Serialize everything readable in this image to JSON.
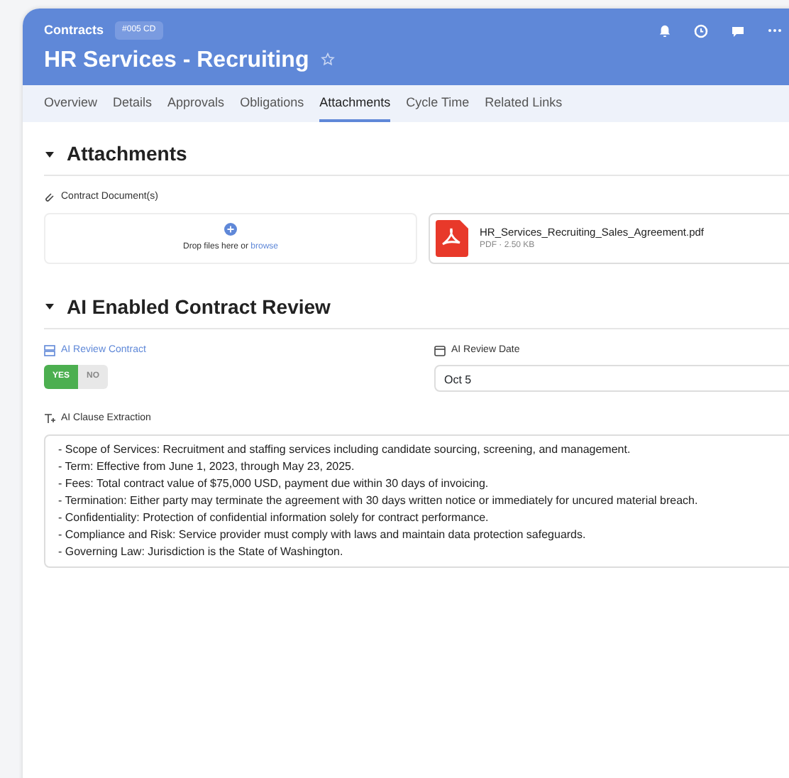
{
  "header": {
    "breadcrumb": "Contracts",
    "badge": "#005 CD",
    "title": "HR Services - Recruiting",
    "starred": false
  },
  "tabs": [
    {
      "label": "Overview",
      "selected": false
    },
    {
      "label": "Details",
      "selected": false
    },
    {
      "label": "Approvals",
      "selected": false
    },
    {
      "label": "Obligations",
      "selected": false
    },
    {
      "label": "Attachments",
      "selected": true
    },
    {
      "label": "Cycle Time",
      "selected": false
    },
    {
      "label": "Related Links",
      "selected": false
    }
  ],
  "attachments": {
    "heading": "Attachments",
    "expanded": true,
    "field_label": "Contract Document(s)",
    "drop_text": "Drop files here or",
    "browse_link": "browse",
    "files": [
      {
        "name": "HR_Services_Recruiting_Sales_Agreement.pdf",
        "meta": "PDF · 2.50 KB"
      }
    ]
  },
  "review": {
    "heading": "AI Enabled Contract Review",
    "expanded": true,
    "toggle_label": "AI Review Contract",
    "toggle_options": [
      {
        "label": "YES",
        "selected": true
      },
      {
        "label": "NO",
        "selected": false
      }
    ],
    "date_label": "AI Review Date",
    "date_value": "Oct 5",
    "clause_label": "AI Clause Extraction",
    "clauses": [
      "- Scope of Services: Recruitment and staffing services including candidate sourcing, screening, and management.",
      "- Term: Effective from June 1, 2023, through May 23, 2025.",
      "- Fees: Total contract value of $75,000 USD, payment due within 30 days of invoicing.",
      "- Termination: Either party may terminate the agreement with 30 days written notice or immediately for uncured material breach.",
      "- Confidentiality: Protection of confidential information solely for contract performance.",
      "- Compliance and Risk: Service provider must comply with laws and maintain data protection safeguards.",
      "- Governing Law: Jurisdiction is the State of Washington."
    ]
  }
}
